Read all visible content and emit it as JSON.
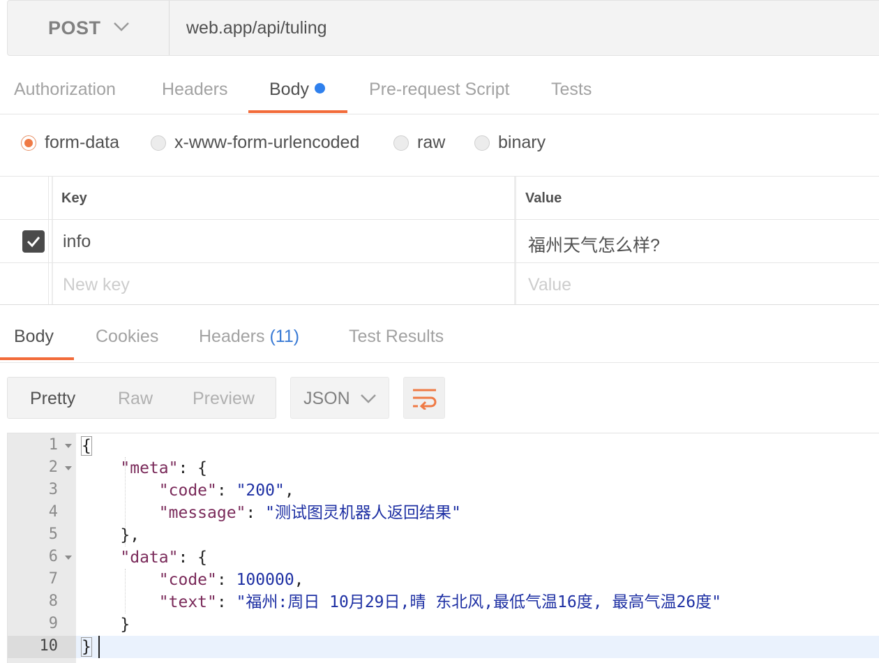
{
  "request": {
    "method": "POST",
    "url": "web.app/api/tuling"
  },
  "request_tabs": [
    {
      "label": "Authorization",
      "active": false
    },
    {
      "label": "Headers",
      "active": false
    },
    {
      "label": "Body",
      "active": true
    },
    {
      "label": "Pre-request Script",
      "active": false
    },
    {
      "label": "Tests",
      "active": false
    }
  ],
  "body_types": [
    {
      "label": "form-data",
      "selected": true
    },
    {
      "label": "x-www-form-urlencoded",
      "selected": false
    },
    {
      "label": "raw",
      "selected": false
    },
    {
      "label": "binary",
      "selected": false
    }
  ],
  "params_table": {
    "key_header": "Key",
    "value_header": "Value",
    "rows": [
      {
        "enabled": true,
        "key": "info",
        "value": "福州天气怎么样?"
      }
    ],
    "new_key_placeholder": "New key",
    "new_value_placeholder": "Value"
  },
  "response_tabs": [
    {
      "label": "Body",
      "active": true
    },
    {
      "label": "Cookies",
      "active": false
    },
    {
      "label": "Headers",
      "count": "(11)",
      "active": false
    },
    {
      "label": "Test Results",
      "active": false
    }
  ],
  "view_modes": [
    {
      "label": "Pretty",
      "active": true
    },
    {
      "label": "Raw",
      "active": false
    },
    {
      "label": "Preview",
      "active": false
    }
  ],
  "format": "JSON",
  "icons": {
    "method_dropdown": "chevron-down-icon",
    "format_dropdown": "chevron-down-icon",
    "wrap": "wrap-lines-icon",
    "checkbox": "checkmark-icon"
  },
  "colors": {
    "accent": "#f26b3a",
    "dot": "#2f80ed",
    "json_key": "#7a2a5a",
    "json_value": "#1d2fa3"
  },
  "response_body": {
    "line_numbers": [
      "1",
      "2",
      "3",
      "4",
      "5",
      "6",
      "7",
      "8",
      "9",
      "10"
    ],
    "tokens": {
      "meta_key": "\"meta\"",
      "code_key": "\"code\"",
      "code_val": "\"200\"",
      "message_key": "\"message\"",
      "message_val": "\"测试图灵机器人返回结果\"",
      "data_key": "\"data\"",
      "code2_val": "100000",
      "text_key": "\"text\"",
      "text_val": "\"福州:周日 10月29日,晴 东北风,最低气温16度, 最高气温26度\""
    }
  }
}
